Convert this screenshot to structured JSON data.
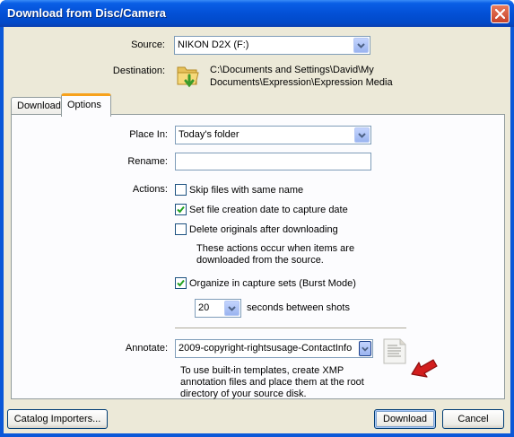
{
  "window": {
    "title": "Download from Disc/Camera"
  },
  "source": {
    "label": "Source:",
    "value": "NIKON D2X (F:)"
  },
  "destination": {
    "label": "Destination:",
    "path_line1": "C:\\Documents and Settings\\David\\My",
    "path_line2": "Documents\\Expression\\Expression Media"
  },
  "tabs": [
    {
      "label": "Download",
      "active": false
    },
    {
      "label": "Options",
      "active": true
    }
  ],
  "options": {
    "place_in": {
      "label": "Place In:",
      "value": "Today's folder"
    },
    "rename": {
      "label": "Rename:",
      "value": ""
    },
    "actions": {
      "label": "Actions:",
      "items": [
        {
          "label": "Skip files with same name",
          "checked": false
        },
        {
          "label": "Set file creation date to capture date",
          "checked": true
        },
        {
          "label": "Delete originals after downloading",
          "checked": false
        }
      ],
      "note_line1": "These actions occur when items are",
      "note_line2": "downloaded from the source."
    },
    "burst": {
      "label": "Organize in capture sets (Burst Mode)",
      "checked": true
    },
    "seconds": {
      "value": "20",
      "suffix": "seconds between shots"
    },
    "annotate": {
      "label": "Annotate:",
      "value": "2009-copyright-rightsusage-ContactInfo",
      "help_line1": "To use built-in templates, create XMP",
      "help_line2": "annotation files and place them at the root",
      "help_line3": "directory of your source disk."
    }
  },
  "buttons": {
    "catalog_importers": "Catalog Importers...",
    "download": "Download",
    "cancel": "Cancel"
  },
  "colors": {
    "accent_tab": "#f7a21c",
    "arrow_annotation": "#d21e1e",
    "titlebar": "#0350d6"
  }
}
